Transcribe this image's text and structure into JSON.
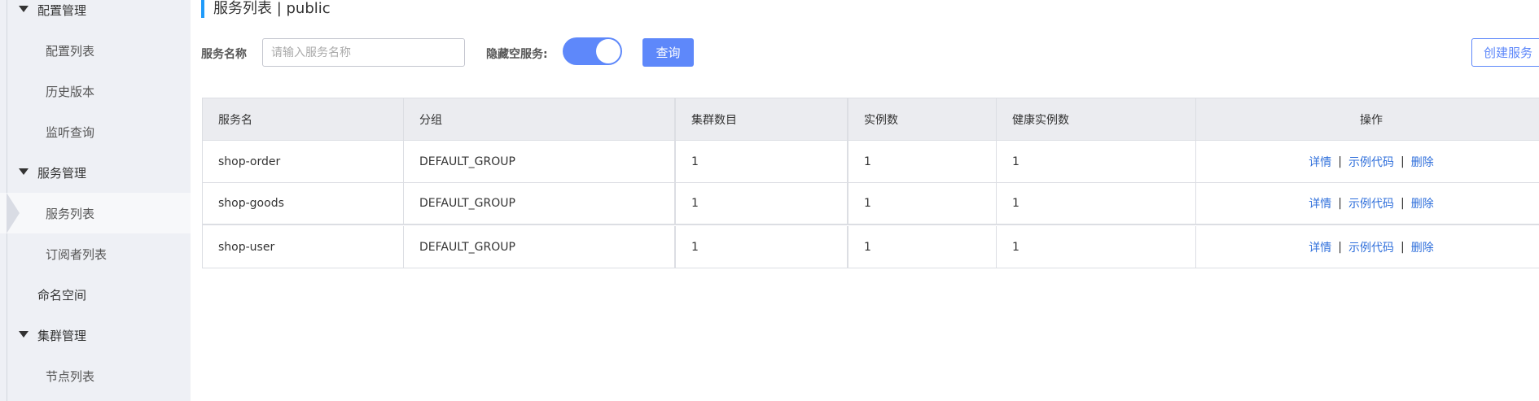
{
  "sidebar": {
    "groups": [
      {
        "label": "配置管理",
        "items": [
          "配置列表",
          "历史版本",
          "监听查询"
        ]
      },
      {
        "label": "服务管理",
        "items": [
          "服务列表",
          "订阅者列表"
        ]
      },
      {
        "label": "命名空间"
      },
      {
        "label": "集群管理",
        "items": [
          "节点列表"
        ]
      }
    ],
    "active_item": "服务列表"
  },
  "header": {
    "title": "服务列表  |  public"
  },
  "filters": {
    "service_name_label": "服务名称",
    "service_name_placeholder": "请输入服务名称",
    "service_name_value": "",
    "hide_empty_label": "隐藏空服务:",
    "hide_empty_on": true,
    "query_button": "查询",
    "create_button": "创建服务"
  },
  "table": {
    "columns": [
      "服务名",
      "分组",
      "集群数目",
      "实例数",
      "健康实例数",
      "操作"
    ],
    "rows": [
      {
        "name": "shop-order",
        "group": "DEFAULT_GROUP",
        "clusters": "1",
        "instances": "1",
        "healthy": "1"
      },
      {
        "name": "shop-goods",
        "group": "DEFAULT_GROUP",
        "clusters": "1",
        "instances": "1",
        "healthy": "1"
      },
      {
        "name": "shop-user",
        "group": "DEFAULT_GROUP",
        "clusters": "1",
        "instances": "1",
        "healthy": "1"
      }
    ],
    "actions": {
      "detail": "详情",
      "sample_code": "示例代码",
      "delete": "删除",
      "separator": "|"
    }
  },
  "colors": {
    "accent": "#5e88fa",
    "title_bar": "#209bfa",
    "link": "#2f6fdb",
    "sidebar_bg": "#eef0f5",
    "table_header_bg": "#ebecf0"
  }
}
